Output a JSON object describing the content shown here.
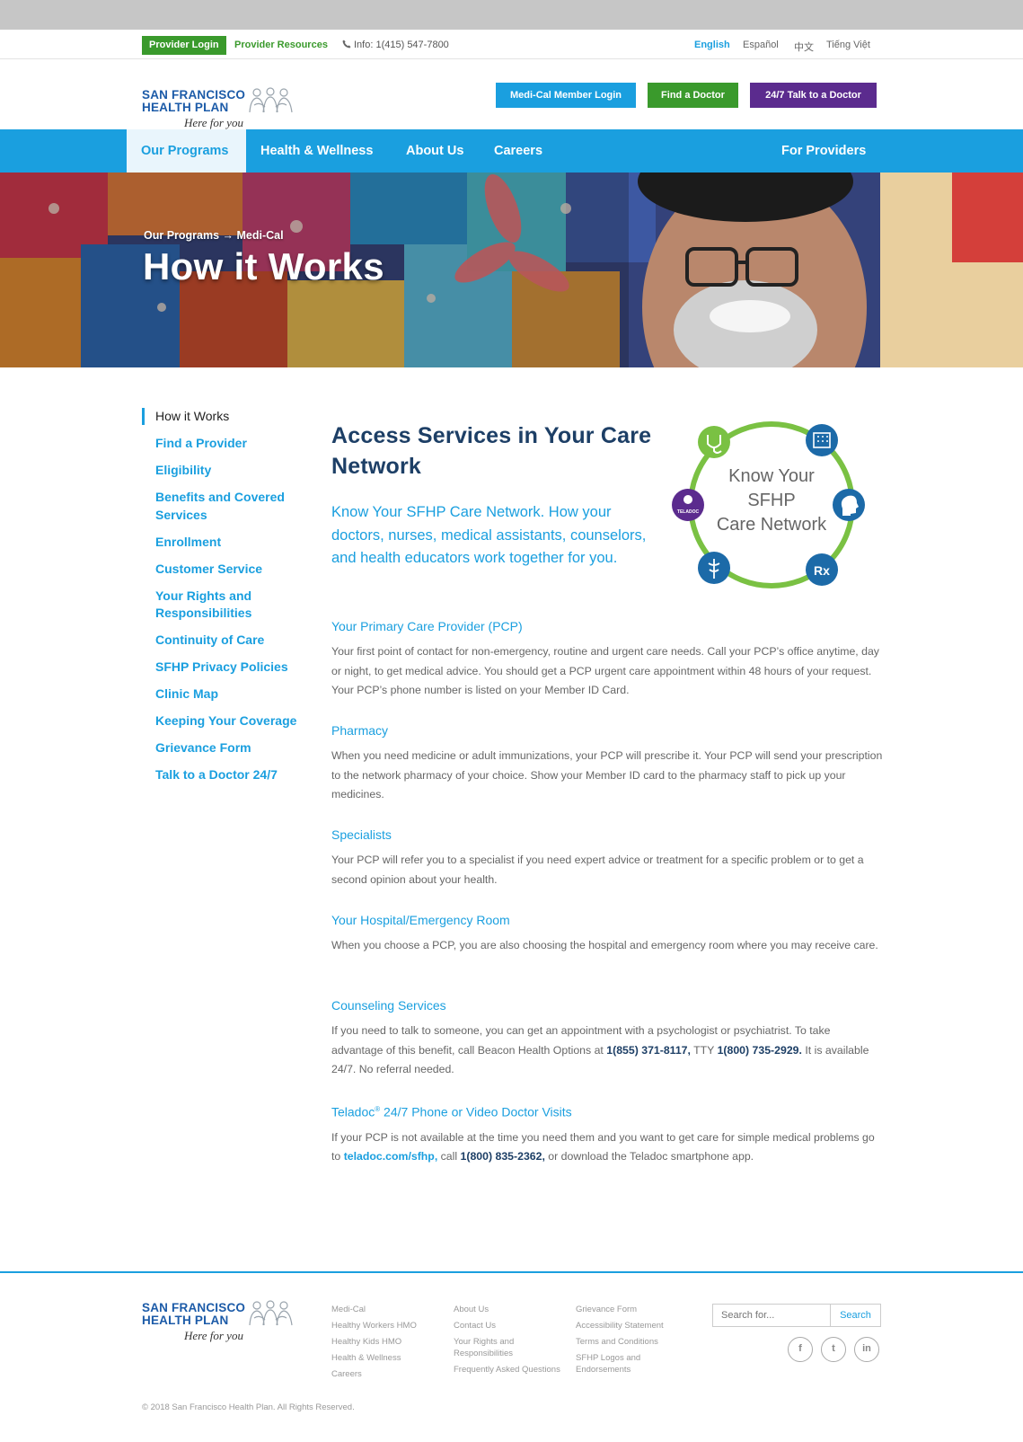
{
  "utility": {
    "provider_login": "Provider Login",
    "provider_resources": "Provider Resources",
    "info_phone": "Info: 1(415) 547-7800",
    "languages": [
      "English",
      "Español",
      "中文",
      "Tiếng Việt"
    ],
    "active_language": "English"
  },
  "logo": {
    "line1": "SAN FRANCISCO",
    "line2": "HEALTH PLAN",
    "tagline": "Here for you"
  },
  "header": {
    "medi_cal_login": "Medi-Cal Member Login",
    "find_doctor": "Find a Doctor",
    "talk_to_doctor": "24/7 Talk to a Doctor"
  },
  "nav": {
    "items": [
      "Our Programs",
      "Health & Wellness",
      "About Us",
      "Careers"
    ],
    "active": "Our Programs",
    "right_item": "For Providers"
  },
  "hero": {
    "breadcrumb": "Our Programs → Medi-Cal",
    "title": "How it Works"
  },
  "sidebar": {
    "items": [
      "How it Works",
      "Find a Provider",
      "Eligibility",
      "Benefits and Covered Services",
      "Enrollment",
      "Customer Service",
      "Your Rights and Responsibilities",
      "Continuity of Care",
      "SFHP Privacy Policies",
      "Clinic Map",
      "Keeping Your Coverage",
      "Grievance Form",
      "Talk to a Doctor 24/7"
    ],
    "active": "How it Works"
  },
  "content": {
    "title": "Access Services in Your Care Network",
    "intro": "Know Your SFHP Care Network. How your doctors, nurses, medical assistants, counselors, and health educators work together for you.",
    "network_graphic": {
      "line1": "Know Your",
      "line2": "SFHP",
      "line3": "Care Network",
      "teladoc_badge": "TELADOC",
      "rx_label": "Rx"
    },
    "pcp": {
      "heading": "Your Primary Care Provider (PCP)",
      "body": "Your first point of contact for non-emergency, routine and urgent care needs. Call your PCP’s office anytime, day or night, to get medical advice. You should get a PCP urgent care appointment within 48 hours of your request. Your PCP’s phone number is listed on your Member ID Card."
    },
    "pharmacy": {
      "heading": "Pharmacy",
      "body": "When you need medicine or adult immunizations, your PCP will prescribe it. Your PCP will send your prescription to the network pharmacy of your choice. Show your Member ID card to the pharmacy staff to pick up your medicines."
    },
    "specialists": {
      "heading": "Specialists",
      "body": "Your PCP will refer you to a specialist if you need expert advice or treatment for a specific problem or to get a second opinion about your health."
    },
    "hospital": {
      "heading": "Your Hospital/Emergency Room",
      "body": "When you choose a PCP, you are also choosing the hospital and emergency room where you may receive care."
    },
    "counseling": {
      "heading": "Counseling Services",
      "body_1": "If you need to talk to someone, you can get an appointment with a psychologist or psychiatrist. To take advantage of this benefit, call Beacon Health Options at ",
      "phone_1": "1(855) 371-8117,",
      "body_2": " TTY ",
      "phone_2": "1(800) 735-2929.",
      "body_3": " It is available 24/7. No referral needed."
    },
    "teladoc": {
      "heading_brand": "Teladoc",
      "heading_reg": "®",
      "heading_rest": " 24/7 Phone or Video Doctor Visits",
      "body_1": "If your PCP is not available at the time you need them and you want to get care for simple medical problems go to ",
      "link": "teladoc.com/sfhp,",
      "body_2": " call ",
      "phone": "1(800) 835-2362,",
      "body_3": " or download the Teladoc smartphone app."
    }
  },
  "footer": {
    "col1": [
      "Medi-Cal",
      "Healthy Workers HMO",
      "Healthy Kids HMO",
      "Health & Wellness",
      "Careers"
    ],
    "col2": [
      "About Us",
      "Contact Us",
      "Your Rights and Responsibilities",
      "Frequently Asked Questions"
    ],
    "col3": [
      "Grievance Form",
      "Accessibility Statement",
      "Terms and Conditions",
      "SFHP Logos and Endorsements"
    ],
    "search_placeholder": "Search for...",
    "search_button": "Search",
    "social": [
      "f",
      "t",
      "in"
    ],
    "copyright": "© 2018 San Francisco Health Plan. All Rights Reserved."
  },
  "colors": {
    "primary_blue": "#1a9fdf",
    "navy": "#1d3f66",
    "green": "#3a9a2c",
    "purple": "#5b2b8e",
    "ring_green": "#7ac143"
  }
}
